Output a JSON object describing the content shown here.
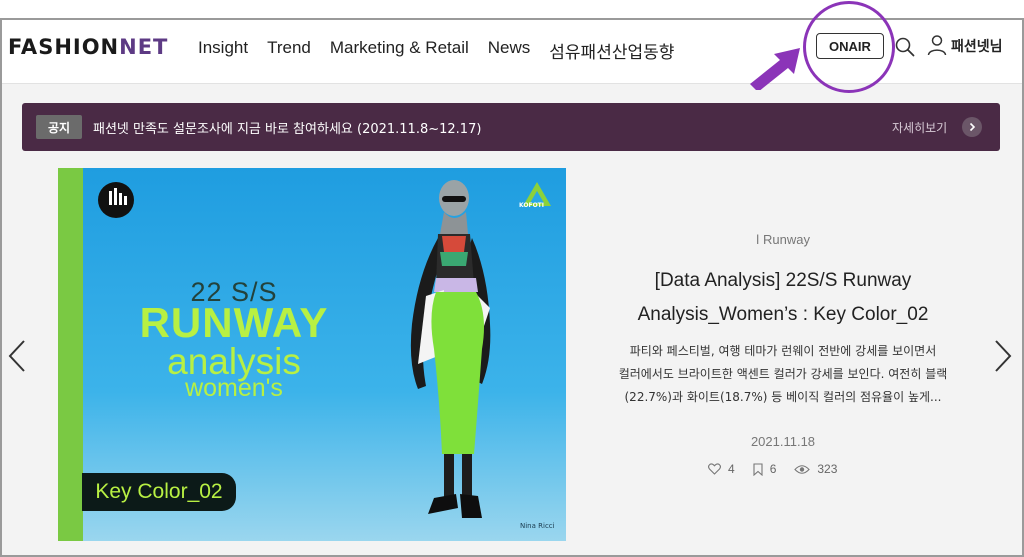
{
  "header": {
    "logo": {
      "part1": "FASHION",
      "part2": "NET"
    },
    "nav": [
      "Insight",
      "Trend",
      "Marketing & Retail",
      "News",
      "섬유패션산업동향"
    ],
    "onair_label": "ONAIR",
    "username": "패션넷님"
  },
  "notice": {
    "badge": "공지",
    "text": "패션넷 만족도 설문조사에 지금 바로 참여하세요 (2021.11.8~12.17)",
    "more": "자세히보기"
  },
  "banner": {
    "line1": "22 S/S",
    "line2": "RUNWAY",
    "line3": "analysis",
    "line4": "women's",
    "key_label": "Key Color_02",
    "kofoti": "KOFOTI",
    "credit": "Nina Ricci"
  },
  "article": {
    "category": "Runway",
    "title_line1": "[Data Analysis] 22S/S Runway",
    "title_line2": "Analysis_Women’s : Key Color_02",
    "desc_line1": "파티와 페스티벌, 여행 테마가 런웨이 전반에 강세를 보이면서",
    "desc_line2": "컬러에서도 브라이트한 액센트 컬러가 강세를 보인다. 여전히 블랙",
    "desc_line3": "(22.7%)과 화이트(18.7%) 등 베이직 컬러의 점유율이 높게...",
    "date": "2021.11.18",
    "likes": "4",
    "bookmarks": "6",
    "views": "323"
  },
  "colors": {
    "brand": "#5d3a84",
    "notice_bg": "#4a2a45",
    "annotation": "#8b34b8",
    "banner_blue": "#2aa8e4",
    "banner_green": "#b8f043"
  }
}
